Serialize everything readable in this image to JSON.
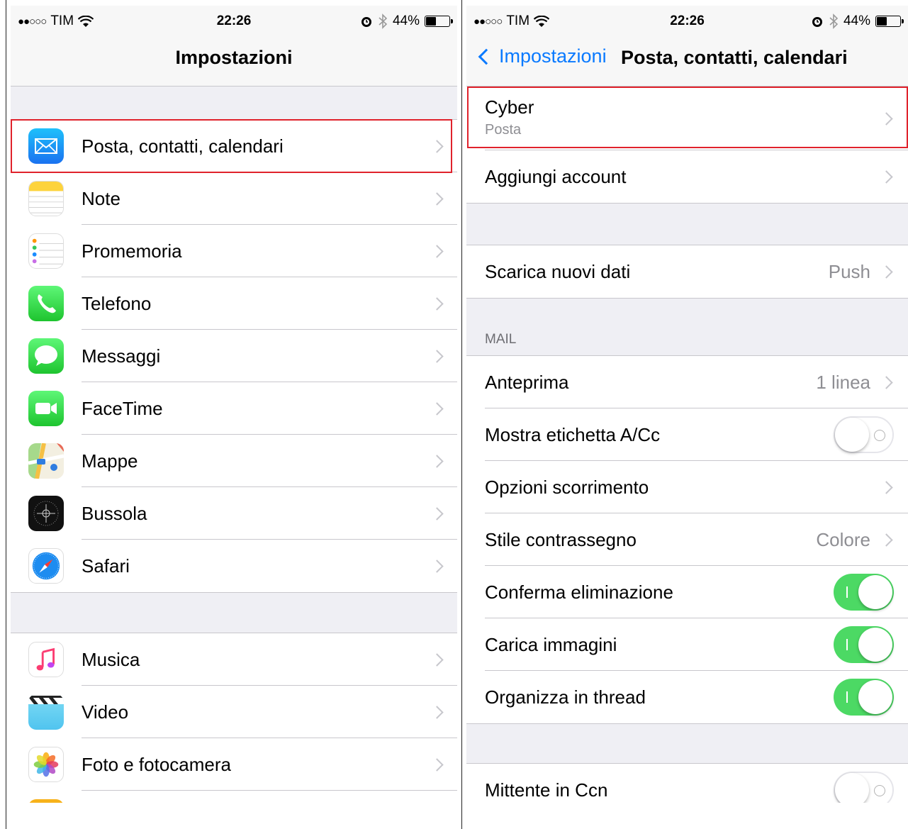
{
  "left": {
    "status": {
      "carrier": "TIM",
      "signal": "●●○○○",
      "time": "22:26",
      "battery": "44%",
      "battery_level": 0.44
    },
    "title": "Impostazioni",
    "items": [
      {
        "label": "Posta, contatti, calendari",
        "icon": "mail-icon"
      },
      {
        "label": "Note",
        "icon": "notes-icon"
      },
      {
        "label": "Promemoria",
        "icon": "reminders-icon"
      },
      {
        "label": "Telefono",
        "icon": "phone-icon"
      },
      {
        "label": "Messaggi",
        "icon": "messages-icon"
      },
      {
        "label": "FaceTime",
        "icon": "facetime-icon"
      },
      {
        "label": "Mappe",
        "icon": "maps-icon"
      },
      {
        "label": "Bussola",
        "icon": "compass-icon"
      },
      {
        "label": "Safari",
        "icon": "safari-icon"
      }
    ],
    "items2": [
      {
        "label": "Musica",
        "icon": "music-icon"
      },
      {
        "label": "Video",
        "icon": "video-icon"
      },
      {
        "label": "Foto e fotocamera",
        "icon": "photos-icon"
      }
    ],
    "colors": {
      "highlight": "#e0222c",
      "mail": "#1b8cf5",
      "phone": "#34c759",
      "tint": "#0a7aff"
    }
  },
  "right": {
    "status": {
      "carrier": "TIM",
      "signal": "●●○○○",
      "time": "22:26",
      "battery": "44%",
      "battery_level": 0.44
    },
    "back_label": "Impostazioni",
    "title": "Posta, contatti, calendari",
    "account": {
      "title": "Cyber",
      "subtitle": "Posta"
    },
    "add_account": "Aggiungi account",
    "fetch": {
      "label": "Scarica nuovi dati",
      "value": "Push"
    },
    "mail_header": "MAIL",
    "mail_rows": [
      {
        "label": "Anteprima",
        "value": "1 linea",
        "type": "disclosure"
      },
      {
        "label": "Mostra etichetta A/Cc",
        "type": "toggle",
        "on": false
      },
      {
        "label": "Opzioni scorrimento",
        "type": "disclosure"
      },
      {
        "label": "Stile contrassegno",
        "value": "Colore",
        "type": "disclosure"
      },
      {
        "label": "Conferma eliminazione",
        "type": "toggle",
        "on": true
      },
      {
        "label": "Carica immagini",
        "type": "toggle",
        "on": true
      },
      {
        "label": "Organizza in thread",
        "type": "toggle",
        "on": true
      }
    ],
    "bcc": {
      "label": "Mittente in Ccn",
      "on": false
    },
    "colors": {
      "toggle_on": "#4cd964",
      "highlight": "#e0222c"
    }
  }
}
